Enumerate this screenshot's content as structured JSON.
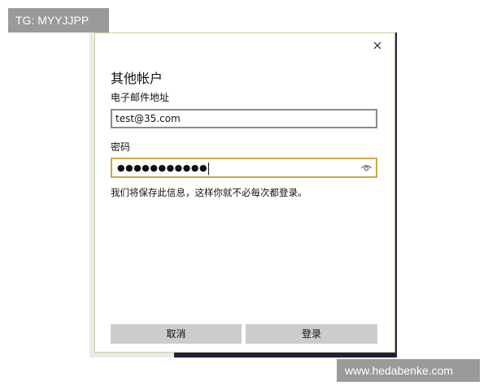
{
  "watermarks": {
    "top_left": "TG: MYYJJPP",
    "bottom_right": "www.hedabenke.com"
  },
  "dialog": {
    "title": "其他帐户",
    "close_icon": "close-icon",
    "email": {
      "label": "电子邮件地址",
      "value": "test@35.com"
    },
    "password": {
      "label": "密码",
      "masked_value": "●●●●●●●●●●●",
      "reveal_icon": "eye-icon"
    },
    "hint": "我们将保存此信息，这样你就不必每次都登录。",
    "buttons": {
      "cancel": "取消",
      "sign_in": "登录"
    }
  },
  "colors": {
    "focus_border": "#c9a64a",
    "button_bg": "#cccccc",
    "desktop": "#1b2142"
  }
}
